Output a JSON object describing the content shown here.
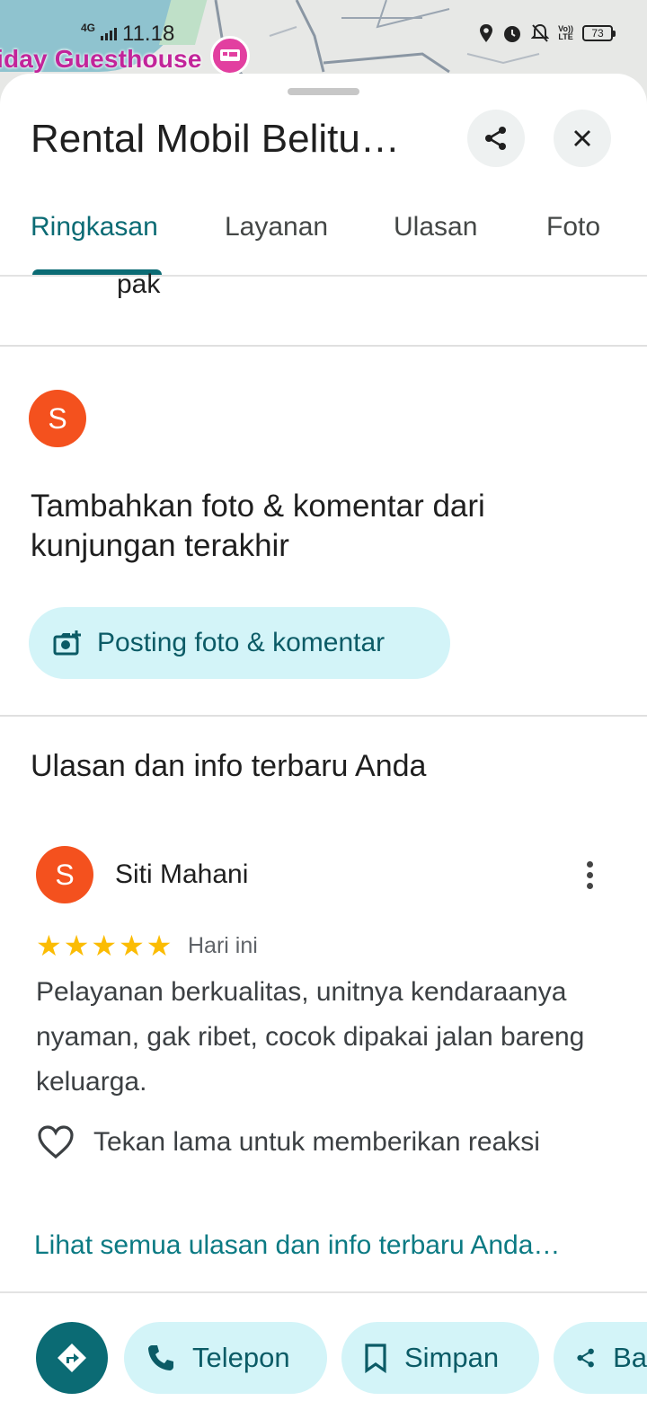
{
  "status_bar": {
    "network": "4G",
    "time": "11.18",
    "volte_label_top": "Vo))",
    "volte_label_bottom": "LTE",
    "battery": "73"
  },
  "map": {
    "place_label": "iday Guesthouse"
  },
  "header": {
    "title": "Rental Mobil Belitu…"
  },
  "tabs": [
    {
      "label": "Ringkasan",
      "active": true
    },
    {
      "label": "Layanan",
      "active": false
    },
    {
      "label": "Ulasan",
      "active": false
    },
    {
      "label": "Foto",
      "active": false
    }
  ],
  "clipped_text": "pak",
  "add_review": {
    "avatar_letter": "S",
    "prompt": "Tambahkan foto & komentar dari kunjungan terakhir",
    "button_label": "Posting foto & komentar"
  },
  "your_reviews": {
    "section_title": "Ulasan dan info terbaru Anda",
    "review": {
      "avatar_letter": "S",
      "author": "Siti Mahani",
      "rating": 5,
      "date": "Hari ini",
      "text": "Pelayanan berkualitas, unitnya kendaraanya nyaman, gak ribet, cocok dipakai jalan bareng keluarga.",
      "reaction_hint": "Tekan lama untuk memberikan reaksi"
    },
    "see_all_link": "Lihat semua ulasan dan info terbaru Anda…"
  },
  "action_bar": {
    "call_label": "Telepon",
    "save_label": "Simpan",
    "share_label": "Ba"
  },
  "colors": {
    "accent": "#0b6b74",
    "pill_bg": "#d3f4f8",
    "avatar": "#f4511e",
    "star": "#fbbc04",
    "map_label": "#c2249a"
  }
}
